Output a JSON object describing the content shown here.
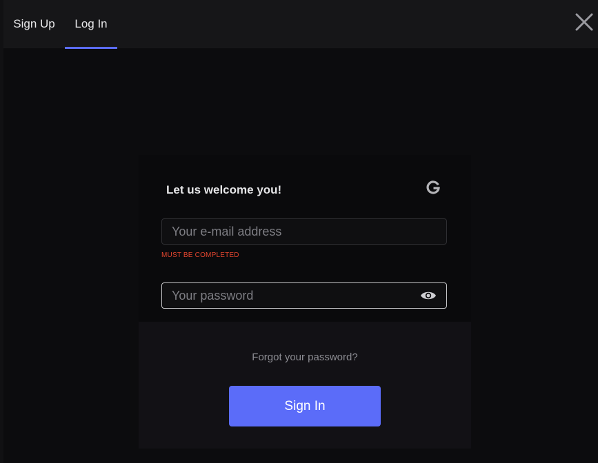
{
  "tabs": {
    "sign_up": "Sign Up",
    "log_in": "Log In",
    "active": "Log In"
  },
  "card": {
    "title": "Let us welcome you!",
    "email": {
      "placeholder": "Your e-mail address",
      "value": "",
      "error": "MUST BE COMPLETED"
    },
    "password": {
      "placeholder": "Your password",
      "value": ""
    },
    "forgot_label": "Forgot your password?",
    "signin_label": "Sign In"
  },
  "icons": {
    "close": "close-icon",
    "google": "google-icon",
    "eye": "eye-icon"
  },
  "colors": {
    "accent": "#5b6cf9",
    "error": "#e5462f",
    "background": "#0c0c0e",
    "topbar": "#161618"
  }
}
